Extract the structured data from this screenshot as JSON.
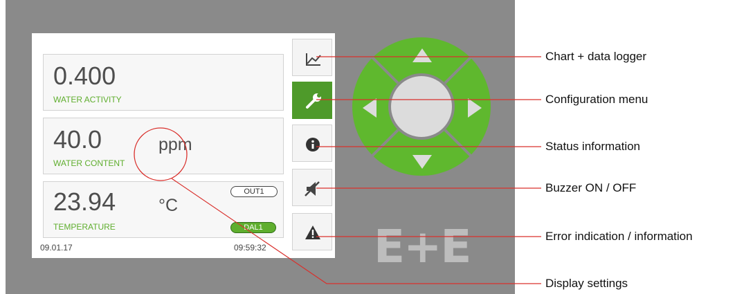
{
  "readings": [
    {
      "value": "0.400",
      "label": "WATER ACTIVITY"
    },
    {
      "value": "40.0",
      "label": "WATER CONTENT",
      "unit": "ppm"
    },
    {
      "value": "23.94",
      "label": "TEMPERATURE",
      "unit": "°C",
      "badges": [
        "OUT1",
        "DAL1"
      ]
    }
  ],
  "footer": {
    "date": "09.01.17",
    "time": "09:59:32"
  },
  "side_buttons": [
    {
      "icon": "chart-icon",
      "active": false
    },
    {
      "icon": "wrench-icon",
      "active": true
    },
    {
      "icon": "info-icon",
      "active": false
    },
    {
      "icon": "buzzer-mute-icon",
      "active": false
    },
    {
      "icon": "warning-icon",
      "active": false
    }
  ],
  "nav_pad": {
    "icons": [
      "arrow-up-icon",
      "arrow-left-icon",
      "arrow-right-icon",
      "arrow-down-icon"
    ],
    "color": "#5fb82e"
  },
  "logo": "E+E",
  "callouts": [
    "Chart + data logger",
    "Configuration menu",
    "Status information",
    "Buzzer ON / OFF",
    "Error indication / information",
    "Display settings"
  ],
  "colors": {
    "accent_green": "#5fae2e",
    "callout_line": "#d9302c",
    "device_gray": "#8a8a8a"
  }
}
